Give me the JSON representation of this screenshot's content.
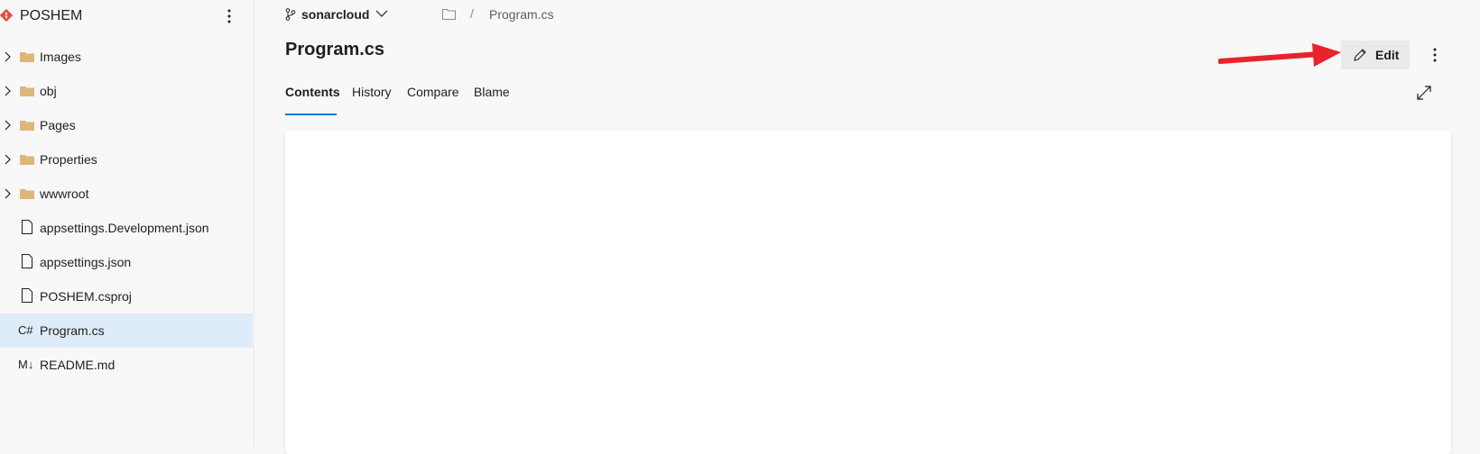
{
  "sidebar": {
    "repo_name": "POSHEM",
    "items": [
      {
        "label": "Images",
        "type": "folder"
      },
      {
        "label": "obj",
        "type": "folder"
      },
      {
        "label": "Pages",
        "type": "folder"
      },
      {
        "label": "Properties",
        "type": "folder"
      },
      {
        "label": "wwwroot",
        "type": "folder"
      },
      {
        "label": "appsettings.Development.json",
        "type": "file"
      },
      {
        "label": "appsettings.json",
        "type": "file"
      },
      {
        "label": "POSHEM.csproj",
        "type": "file"
      },
      {
        "label": "Program.cs",
        "type": "csharp",
        "icon_text": "C#",
        "selected": true
      },
      {
        "label": "README.md",
        "type": "markdown",
        "icon_text": "M↓"
      }
    ]
  },
  "topbar": {
    "branch": "sonarcloud",
    "breadcrumb_separator": "/",
    "breadcrumb_file": "Program.cs"
  },
  "main": {
    "title": "Program.cs",
    "edit_label": "Edit",
    "tabs": [
      {
        "label": "Contents",
        "active": true
      },
      {
        "label": "History"
      },
      {
        "label": "Compare"
      },
      {
        "label": "Blame"
      }
    ]
  },
  "colors": {
    "accent": "#0078d4",
    "selected_bg": "#deecf9",
    "folder": "#dcb67a",
    "logo": "#e74c3c",
    "annotation_arrow": "#e8232a"
  }
}
